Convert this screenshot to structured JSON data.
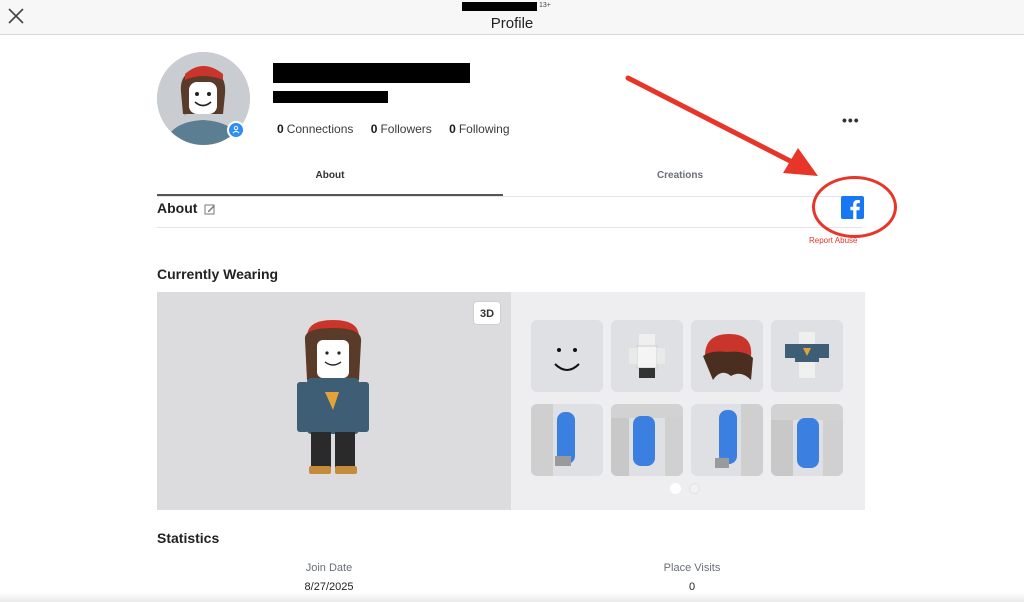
{
  "header": {
    "title": "Profile",
    "age_tag": "13+"
  },
  "profile": {
    "connections": {
      "count": "0",
      "label": "Connections"
    },
    "followers": {
      "count": "0",
      "label": "Followers"
    },
    "following": {
      "count": "0",
      "label": "Following"
    },
    "more_label": "•••"
  },
  "tabs": [
    {
      "label": "About"
    },
    {
      "label": "Creations"
    }
  ],
  "about": {
    "heading": "About",
    "report_label": "Report Abuse"
  },
  "wearing": {
    "heading": "Currently Wearing",
    "view_3d_label": "3D",
    "items": [
      {
        "icon": "smile-face-icon"
      },
      {
        "icon": "white-shirt-icon"
      },
      {
        "icon": "beanie-hair-icon"
      },
      {
        "icon": "blue-jacket-icon"
      },
      {
        "icon": "right-arm-icon"
      },
      {
        "icon": "torso-arm-icon"
      },
      {
        "icon": "left-arm-icon"
      },
      {
        "icon": "leg-icon"
      }
    ]
  },
  "statistics": {
    "heading": "Statistics",
    "join_date": {
      "label": "Join Date",
      "value": "8/27/2025"
    },
    "place_visits": {
      "label": "Place Visits",
      "value": "0"
    }
  },
  "colors": {
    "annotation": "#e8352a",
    "facebook": "#1877f2",
    "accent": "#2f8df5"
  }
}
